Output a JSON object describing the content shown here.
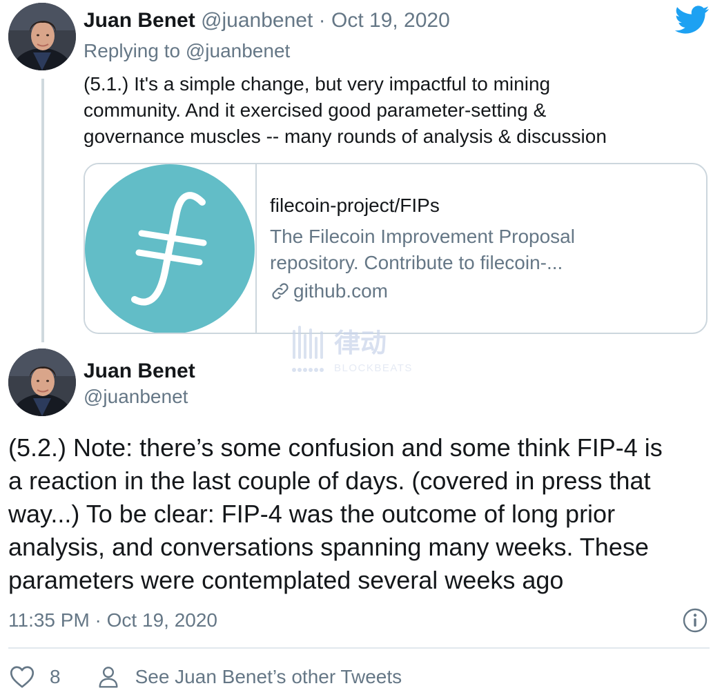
{
  "tweet1": {
    "author_name": "Juan Benet",
    "handle": "@juanbenet",
    "separator": "·",
    "date": "Oct 19, 2020",
    "replying_to": "Replying to @juanbenet",
    "text_lines": [
      "(5.1.) It's a simple change, but very impactful to mining",
      "community. And it exercised good parameter-setting &",
      "governance muscles -- many rounds of analysis & discussion"
    ]
  },
  "link_card": {
    "title": "filecoin-project/FIPs",
    "description_lines": [
      "The Filecoin Improvement Proposal",
      "repository. Contribute to filecoin-..."
    ],
    "domain": "github.com",
    "image_icon": "filecoin-logo",
    "image_color": "#62bdc7"
  },
  "watermark": {
    "icon": "blockbeats-watermark-logo",
    "cjk_text": "律动",
    "latin_text": "BLOCKBEATS"
  },
  "tweet2": {
    "author_name": "Juan Benet",
    "handle": "@juanbenet",
    "text_lines": [
      "(5.2.) Note: there’s some confusion and some think FIP-4 is",
      "a reaction in the last couple of days. (covered in press that",
      "way...) To be clear: FIP-4 was the outcome of long prior",
      "analysis, and conversations spanning many weeks. These",
      "parameters were contemplated several weeks ago"
    ],
    "timestamp": "11:35 PM · Oct 19, 2020",
    "like_count": "8",
    "other_tweets_label": "See Juan Benet’s other Tweets"
  },
  "icons": {
    "brand": "twitter-bird-icon",
    "info": "info-icon",
    "like": "heart-icon",
    "profile": "person-icon",
    "link": "link-icon"
  },
  "colors": {
    "twitter_blue": "#1da1f2",
    "muted_text": "#657786",
    "border": "#ccd6dd",
    "filecoin_teal": "#62bdc7"
  }
}
